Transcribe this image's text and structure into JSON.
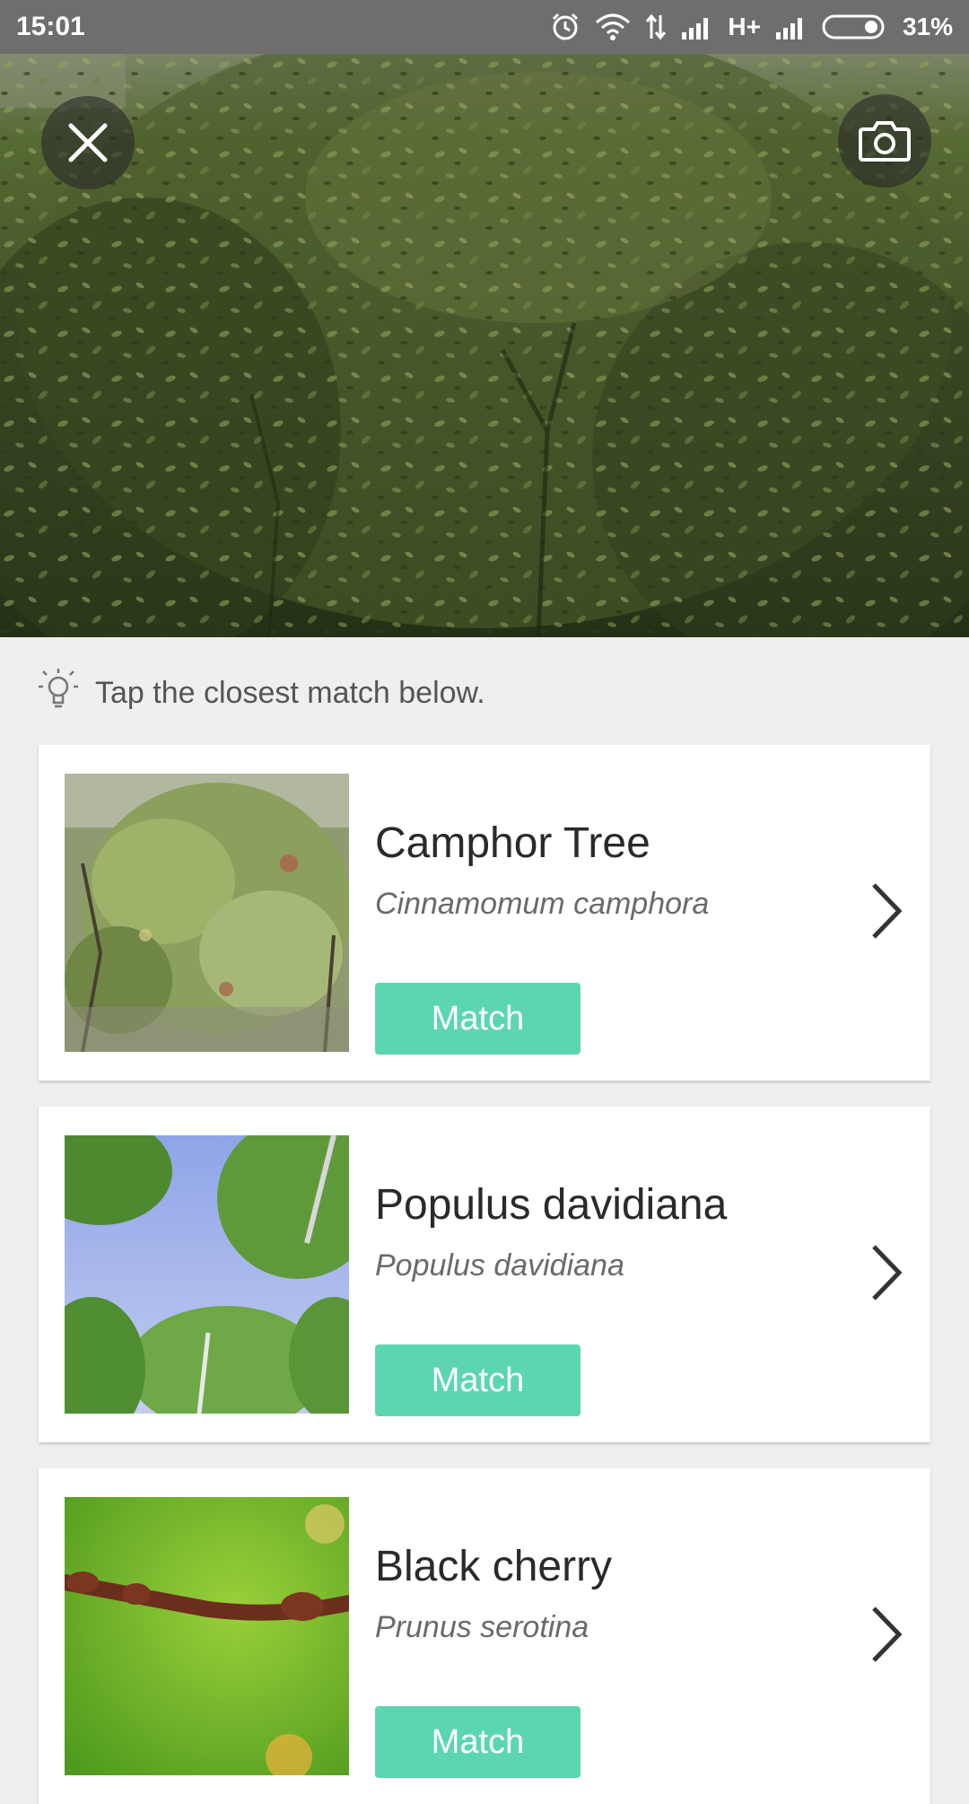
{
  "status_bar": {
    "time": "15:01",
    "network": "H+",
    "battery": "31%",
    "icons": [
      "alarm-icon",
      "wifi-icon",
      "data-arrows-icon",
      "signal-icon",
      "signal-icon",
      "battery-icon"
    ]
  },
  "top_bar": {
    "close_icon": "close-icon",
    "camera_icon": "camera-icon"
  },
  "hint": {
    "icon": "lightbulb-icon",
    "text": "Tap the closest match below."
  },
  "results": [
    {
      "name": "Camphor Tree",
      "scientific": "Cinnamomum camphora",
      "button": "Match"
    },
    {
      "name": "Populus davidiana",
      "scientific": "Populus davidiana",
      "button": "Match"
    },
    {
      "name": "Black cherry",
      "scientific": "Prunus serotina",
      "button": "Match"
    }
  ],
  "colors": {
    "accent": "#5cd6b1",
    "background": "#efefef",
    "status_bar": "#6e6e6e"
  }
}
